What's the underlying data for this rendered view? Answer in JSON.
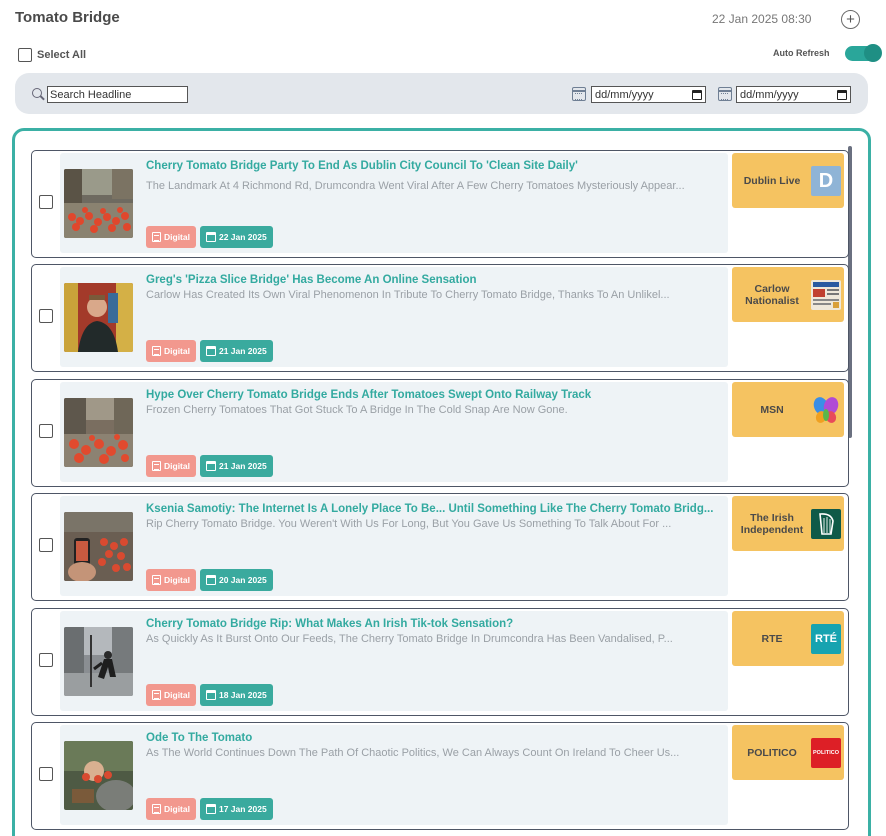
{
  "header": {
    "title": "Tomato Bridge",
    "datetime": "22 Jan 2025 08:30",
    "add_icon": "plus-circle-icon"
  },
  "controls": {
    "select_all_label": "Select All",
    "auto_refresh_label": "Auto Refresh",
    "auto_refresh_on": true
  },
  "search": {
    "placeholder": "Search Headline",
    "date_from_placeholder": "dd/mm/yyyy",
    "date_to_placeholder": "dd/mm/yyyy"
  },
  "colors": {
    "accent": "#3bb0a5",
    "headline": "#33aaa0",
    "digital_tag": "#f2988e",
    "date_tag": "#3aaa9e",
    "source_bg": "#f5c361"
  },
  "articles": [
    {
      "headline": "Cherry Tomato Bridge Party To End As Dublin City Council To 'Clean Site Daily'",
      "summary": "The Landmark At 4 Richmond Rd, Drumcondra Went Viral After A Few Cherry Tomatoes Mysteriously Appear...",
      "tag": "Digital",
      "date": "22 Jan 2025",
      "source": "Dublin Live",
      "logo_text": "D",
      "logo_color": "#8fb4d6"
    },
    {
      "headline": "Greg's 'Pizza Slice Bridge' Has Become An Online Sensation",
      "summary": "Carlow Has Created Its Own Viral Phenomenon In Tribute To Cherry Tomato Bridge, Thanks To An Unlikel...",
      "tag": "Digital",
      "date": "21 Jan 2025",
      "source": "Carlow Nationalist",
      "logo_text": "",
      "logo_color": "#e8e0d0"
    },
    {
      "headline": "Hype Over Cherry Tomato Bridge Ends After Tomatoes Swept Onto Railway Track",
      "summary": "Frozen Cherry Tomatoes That Got Stuck To A Bridge In The Cold Snap Are Now Gone.",
      "tag": "Digital",
      "date": "21 Jan 2025",
      "source": "MSN",
      "logo_text": "",
      "logo_color": "#f5c361"
    },
    {
      "headline": "Ksenia Samotiy: The Internet Is A Lonely Place To Be... Until Something Like The Cherry Tomato Bridg...",
      "summary": "Rip Cherry Tomato Bridge. You Weren't With Us For Long, But You Gave Us Something To Talk About For ...",
      "tag": "Digital",
      "date": "20 Jan 2025",
      "source": "The Irish Independent",
      "logo_text": "",
      "logo_color": "#0f5a48"
    },
    {
      "headline": "Cherry Tomato Bridge Rip: What Makes An Irish Tik-tok Sensation?",
      "summary": "As Quickly As It Burst Onto Our Feeds, The Cherry Tomato Bridge In Drumcondra Has Been Vandalised, P...",
      "tag": "Digital",
      "date": "18 Jan 2025",
      "source": "RTE",
      "logo_text": "RTÉ",
      "logo_color": "#17a3b0"
    },
    {
      "headline": "Ode To The Tomato",
      "summary": "As The World Continues Down The Path Of Chaotic Politics, We Can Always Count On Ireland To Cheer Us...",
      "tag": "Digital",
      "date": "17 Jan 2025",
      "source": "POLITICO",
      "logo_text": "POLITICO",
      "logo_color": "#dd1f26"
    }
  ]
}
